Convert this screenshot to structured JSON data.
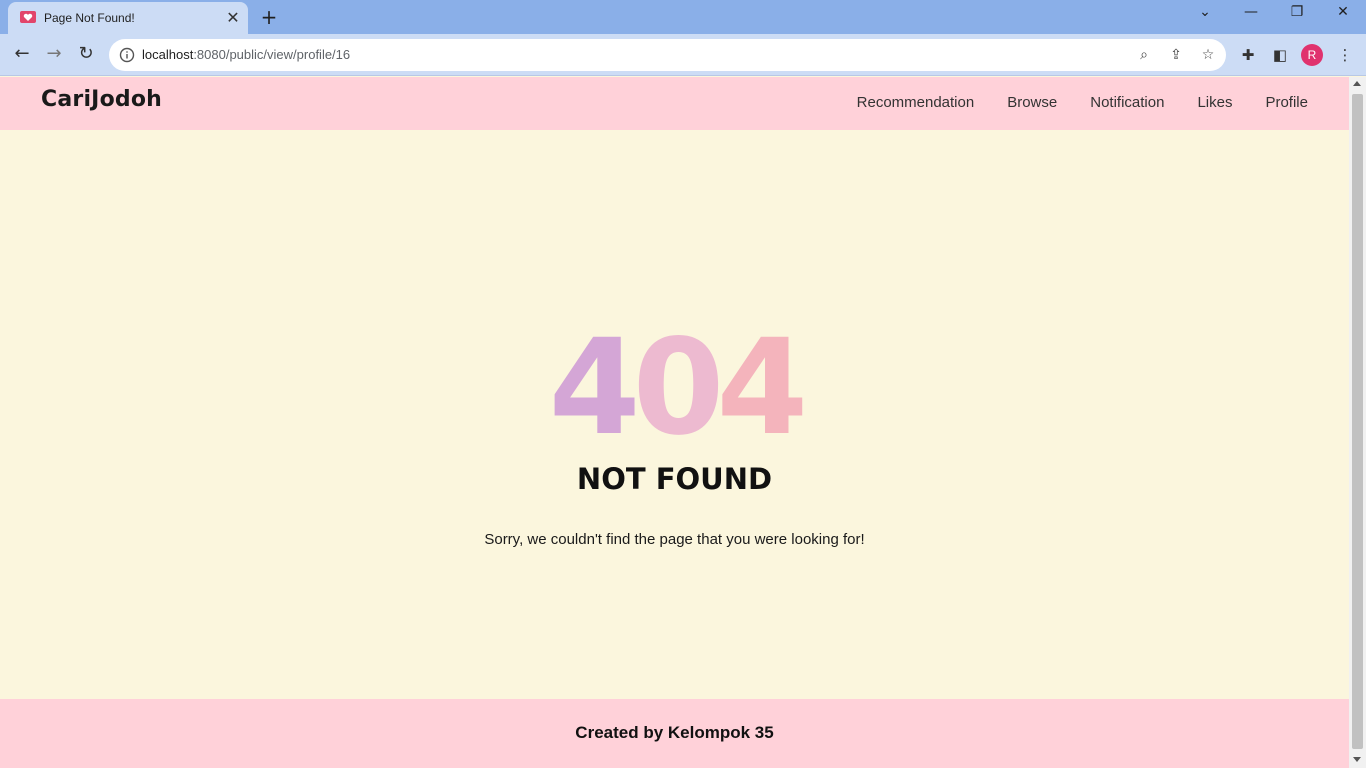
{
  "browser": {
    "tab_title": "Page Not Found!",
    "tab_close": "✕",
    "new_tab": "+",
    "url_host": "localhost",
    "url_rest": ":8080/public/view/profile/16",
    "profile_initial": "R",
    "icons": [
      "back-icon",
      "forward-icon",
      "reload-icon",
      "info-icon",
      "zoom-icon",
      "share-icon",
      "star-icon",
      "extensions-icon",
      "sidepanel-icon",
      "menu-icon"
    ]
  },
  "header": {
    "brand": "CariJodoh",
    "nav": [
      "Recommendation",
      "Browse",
      "Notification",
      "Likes",
      "Profile"
    ]
  },
  "main": {
    "code_digits": [
      "4",
      "0",
      "4"
    ],
    "title": "NOT FOUND",
    "message": "Sorry, we couldn't find the page that you were looking for!"
  },
  "footer": {
    "text": "Created by Kelompok 35"
  },
  "colors": {
    "header_bg": "#ffd1d9",
    "page_bg": "#fbf6dd",
    "digit_1": "#d4a6d6",
    "digit_2": "#ecb4cf",
    "digit_3": "#f4b4bc",
    "avatar_bg": "#e0326e"
  }
}
